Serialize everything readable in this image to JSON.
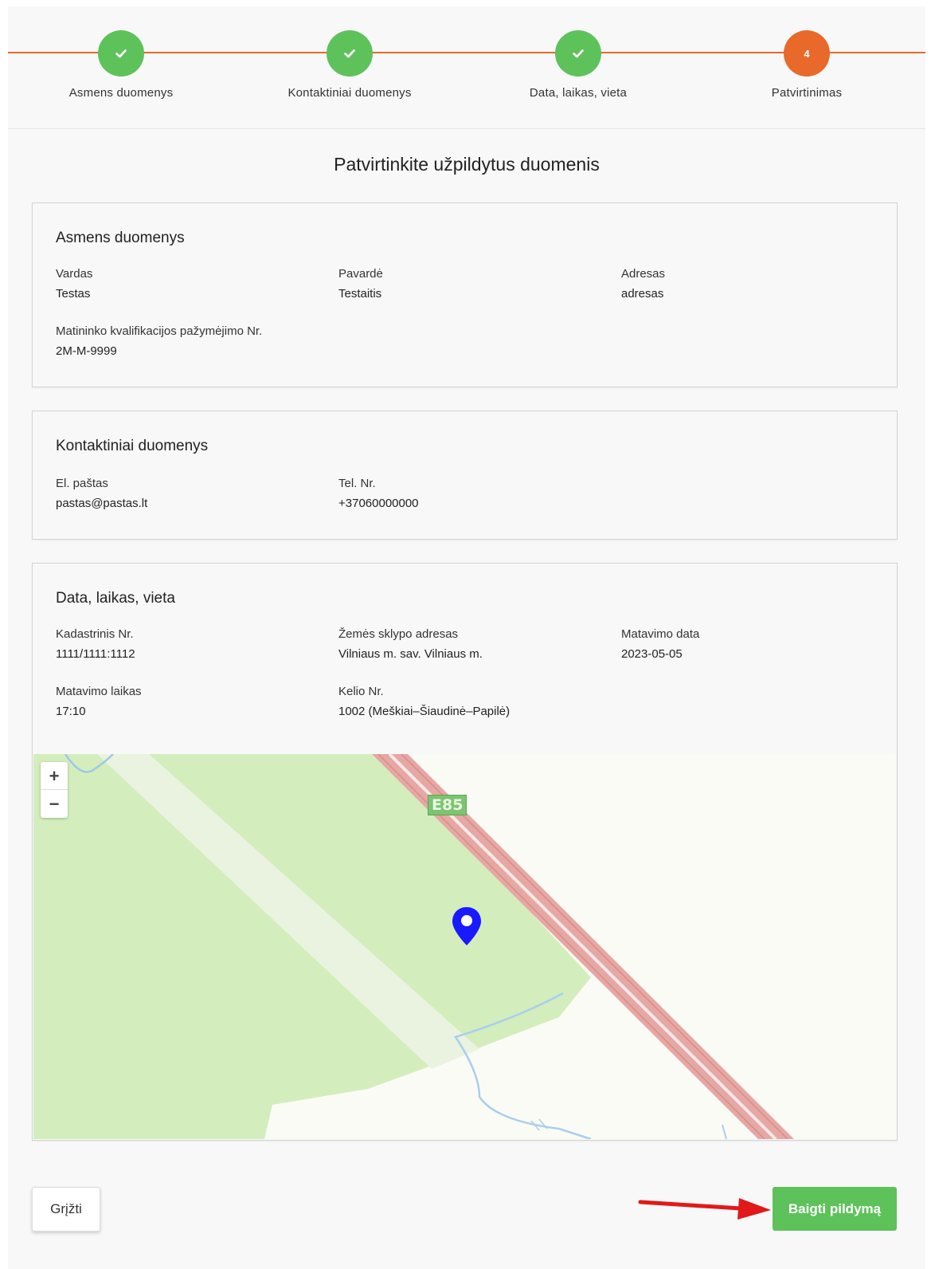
{
  "stepper": {
    "steps": [
      {
        "label": "Asmens duomenys",
        "state": "done"
      },
      {
        "label": "Kontaktiniai duomenys",
        "state": "done"
      },
      {
        "label": "Data, laikas, vieta",
        "state": "done"
      },
      {
        "label": "Patvirtinimas",
        "state": "active",
        "number": "4"
      }
    ],
    "colors": {
      "done": "#5dc25a",
      "active": "#e8692a",
      "line": "#e8692a"
    }
  },
  "page_title": "Patvirtinkite užpildytus duomenis",
  "personal": {
    "title": "Asmens duomenys",
    "first_name_label": "Vardas",
    "first_name": "Testas",
    "last_name_label": "Pavardė",
    "last_name": "Testaitis",
    "address_label": "Adresas",
    "address": "adresas",
    "cert_label": "Matininko kvalifikacijos pažymėjimo Nr.",
    "cert": "2M-M-9999"
  },
  "contacts": {
    "title": "Kontaktiniai duomenys",
    "email_label": "El. paštas",
    "email": "pastas@pastas.lt",
    "phone_label": "Tel. Nr.",
    "phone": "+37060000000"
  },
  "location": {
    "title": "Data, laikas, vieta",
    "cadastral_label": "Kadastrinis Nr.",
    "cadastral": "1111/1111:1112",
    "plot_address_label": "Žemės sklypo adresas",
    "plot_address": "Vilniaus m. sav. Vilniaus m.",
    "date_label": "Matavimo data",
    "date": "2023-05-05",
    "time_label": "Matavimo laikas",
    "time": "17:10",
    "road_label": "Kelio Nr.",
    "road": "1002 (Meškiai–Šiaudinė–Papilė)"
  },
  "map": {
    "zoom_in": "+",
    "zoom_out": "−",
    "road_badge": "E85",
    "marker_icon": "map-pin-icon",
    "marker_color": "#1a1aff"
  },
  "actions": {
    "back_label": "Grįžti",
    "finish_label": "Baigti pildymą",
    "finish_color": "#5dc25a"
  }
}
